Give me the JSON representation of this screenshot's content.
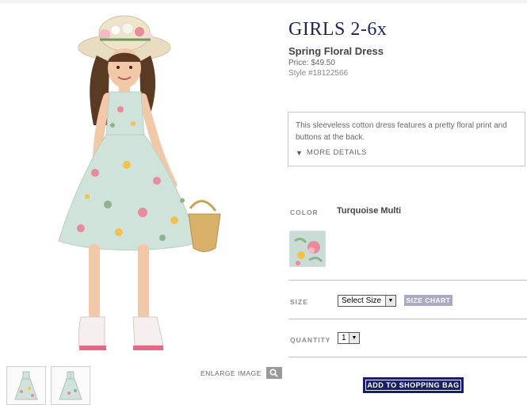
{
  "product": {
    "category": "GIRLS 2-6x",
    "name": "Spring Floral Dress",
    "price": "Price: $49.50",
    "style": "Style #18122566",
    "description": "This sleeveless cotton dress features a pretty floral print and buttons at the back.",
    "more_details": "MORE DETAILS",
    "more_details_icon": "triangle-down-icon"
  },
  "gallery": {
    "enlarge_label": "ENLARGE IMAGE",
    "enlarge_icon": "magnifier-icon",
    "thumbnails": [
      "dress-front-thumbnail",
      "dress-back-thumbnail"
    ]
  },
  "options": {
    "color_label": "COLOR",
    "color_value": "Turquoise Multi",
    "swatch_colors": [
      "#c9ddd6",
      "#e98a9d",
      "#8fb38c"
    ],
    "size_label": "SIZE",
    "size_selected": "Select Size",
    "size_chart": "SIZE CHART",
    "quantity_label": "QUANTITY",
    "quantity_selected": "1"
  },
  "actions": {
    "add_to_bag": "ADD TO SHOPPING BAG"
  },
  "colors": {
    "brand_navy": "#1a1f61",
    "size_chart_bg": "#a9abc2",
    "dress_mint": "#cfe3da"
  }
}
